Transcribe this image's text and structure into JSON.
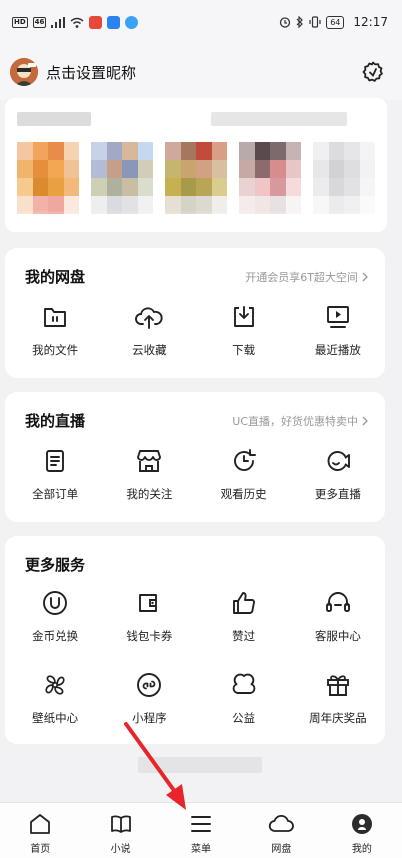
{
  "statusbar": {
    "left_tags": [
      "HD",
      "46"
    ],
    "battery": "64",
    "time": "12:17"
  },
  "header": {
    "nickname": "点击设置昵称"
  },
  "netdisk": {
    "title": "我的网盘",
    "hint": "开通会员享6T超大空间",
    "items": [
      {
        "label": "我的文件",
        "icon": "folder-icon"
      },
      {
        "label": "云收藏",
        "icon": "cloud-upload-icon"
      },
      {
        "label": "下载",
        "icon": "download-icon"
      },
      {
        "label": "最近播放",
        "icon": "play-screen-icon"
      }
    ]
  },
  "live": {
    "title": "我的直播",
    "hint": "UC直播，好货优惠特卖中",
    "items": [
      {
        "label": "全部订单",
        "icon": "order-icon"
      },
      {
        "label": "我的关注",
        "icon": "store-icon"
      },
      {
        "label": "观看历史",
        "icon": "history-icon"
      },
      {
        "label": "更多直播",
        "icon": "live-more-icon"
      }
    ]
  },
  "services": {
    "title": "更多服务",
    "items": [
      {
        "label": "金币兑换",
        "icon": "coin-icon"
      },
      {
        "label": "钱包卡券",
        "icon": "wallet-icon"
      },
      {
        "label": "赞过",
        "icon": "thumbs-up-icon"
      },
      {
        "label": "客服中心",
        "icon": "headset-icon"
      },
      {
        "label": "壁纸中心",
        "icon": "pinwheel-icon"
      },
      {
        "label": "小程序",
        "icon": "mini-program-icon"
      },
      {
        "label": "公益",
        "icon": "charity-icon"
      },
      {
        "label": "周年庆奖品",
        "icon": "gift-icon"
      }
    ]
  },
  "tabs": [
    {
      "label": "首页",
      "icon": "home-icon"
    },
    {
      "label": "小说",
      "icon": "book-icon"
    },
    {
      "label": "菜单",
      "icon": "menu-icon"
    },
    {
      "label": "网盘",
      "icon": "cloud-icon"
    },
    {
      "label": "我的",
      "icon": "profile-icon"
    }
  ],
  "colors": {
    "background": "#f2f2f4",
    "card": "#ffffff",
    "hint": "#999999",
    "arrow": "#e8252b"
  }
}
